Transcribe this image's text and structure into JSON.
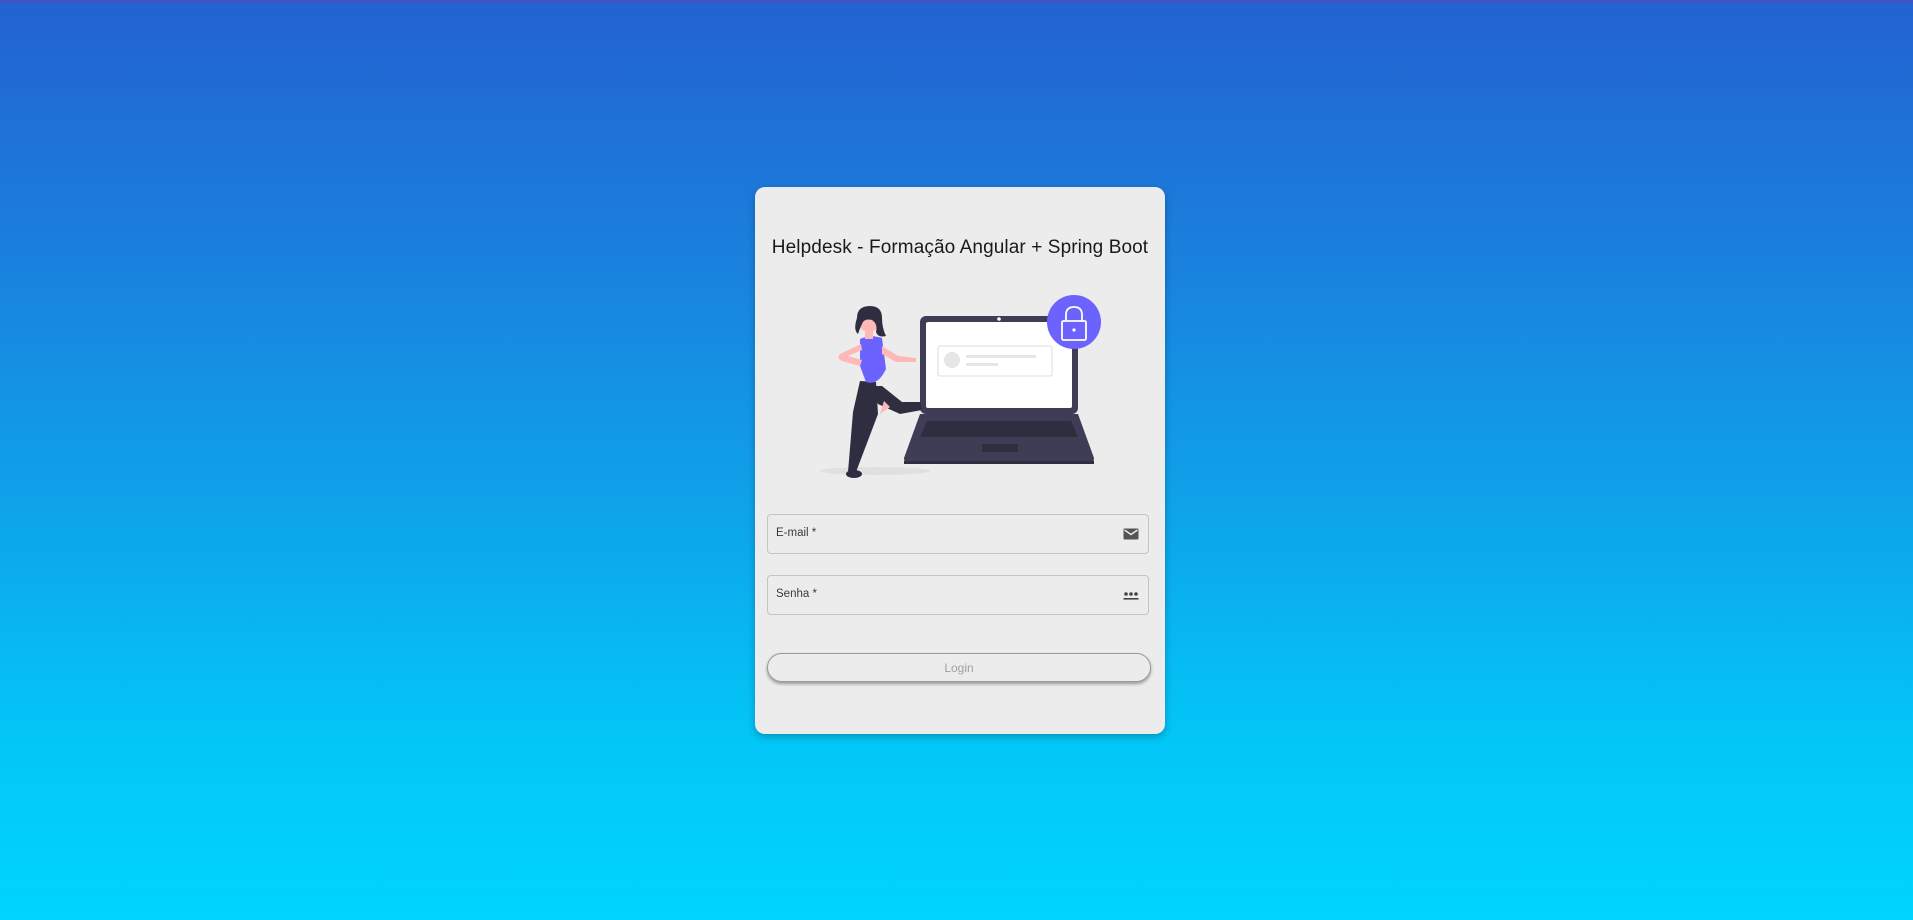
{
  "card": {
    "title": "Helpdesk - Formação Angular + Spring Boot"
  },
  "form": {
    "email": {
      "label": "E-mail *",
      "value": "",
      "icon": "email-icon"
    },
    "password": {
      "label": "Senha *",
      "value": "",
      "icon": "password-icon"
    },
    "login_label": "Login"
  },
  "colors": {
    "gradient_top": "#2362d1",
    "gradient_bottom": "#00d4ff",
    "card_bg": "#ececec",
    "accent_purple": "#6c63ff",
    "laptop_dark": "#3f3d56"
  }
}
